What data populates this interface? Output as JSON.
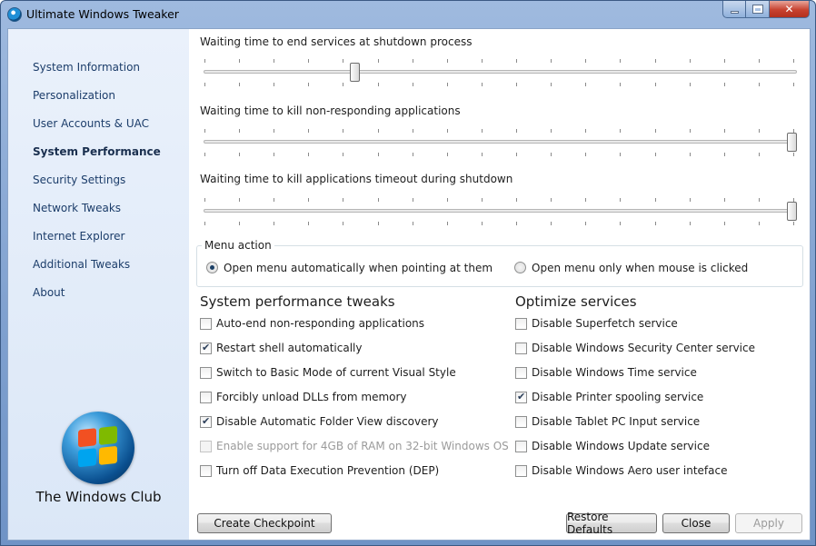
{
  "window": {
    "title": "Ultimate Windows Tweaker"
  },
  "sidebar": {
    "items": [
      {
        "label": "System Information"
      },
      {
        "label": "Personalization"
      },
      {
        "label": "User Accounts & UAC"
      },
      {
        "label": "System Performance"
      },
      {
        "label": "Security Settings"
      },
      {
        "label": "Network Tweaks"
      },
      {
        "label": "Internet Explorer"
      },
      {
        "label": "Additional Tweaks"
      },
      {
        "label": "About"
      }
    ],
    "active": "System Performance",
    "brand": "The Windows Club"
  },
  "sliders": [
    {
      "label": "Waiting time to end services at shutdown process",
      "value_fraction": 0.25
    },
    {
      "label": "Waiting time to kill non-responding applications",
      "value_fraction": 1.0
    },
    {
      "label": "Waiting time to kill applications timeout during shutdown",
      "value_fraction": 1.0
    }
  ],
  "menu_action": {
    "title": "Menu action",
    "options": [
      {
        "label": "Open menu automatically when pointing at them",
        "selected": true
      },
      {
        "label": "Open menu only when mouse is clicked",
        "selected": false
      }
    ]
  },
  "performance": {
    "title": "System performance tweaks",
    "items": [
      {
        "label": "Auto-end non-responding applications",
        "checked": false,
        "enabled": true
      },
      {
        "label": "Restart shell automatically",
        "checked": true,
        "enabled": true
      },
      {
        "label": "Switch to Basic Mode of current Visual Style",
        "checked": false,
        "enabled": true
      },
      {
        "label": "Forcibly unload DLLs from memory",
        "checked": false,
        "enabled": true
      },
      {
        "label": "Disable Automatic Folder View discovery",
        "checked": true,
        "enabled": true
      },
      {
        "label": "Enable support for 4GB of RAM on 32-bit Windows OS",
        "checked": false,
        "enabled": false
      },
      {
        "label": "Turn off Data Execution Prevention (DEP)",
        "checked": false,
        "enabled": true
      }
    ]
  },
  "services": {
    "title": "Optimize services",
    "items": [
      {
        "label": "Disable Superfetch service",
        "checked": false
      },
      {
        "label": "Disable Windows Security Center service",
        "checked": false
      },
      {
        "label": "Disable Windows Time service",
        "checked": false
      },
      {
        "label": "Disable Printer spooling service",
        "checked": true
      },
      {
        "label": "Disable Tablet PC Input service",
        "checked": false
      },
      {
        "label": "Disable Windows Update service",
        "checked": false
      },
      {
        "label": "Disable Windows Aero user inteface",
        "checked": false
      }
    ]
  },
  "buttons": {
    "checkpoint": "Create Checkpoint",
    "restore": "Restore Defaults",
    "close": "Close",
    "apply": "Apply"
  },
  "icons": {
    "app": "uwt-app-icon",
    "logo": "windows-logo-icon"
  }
}
